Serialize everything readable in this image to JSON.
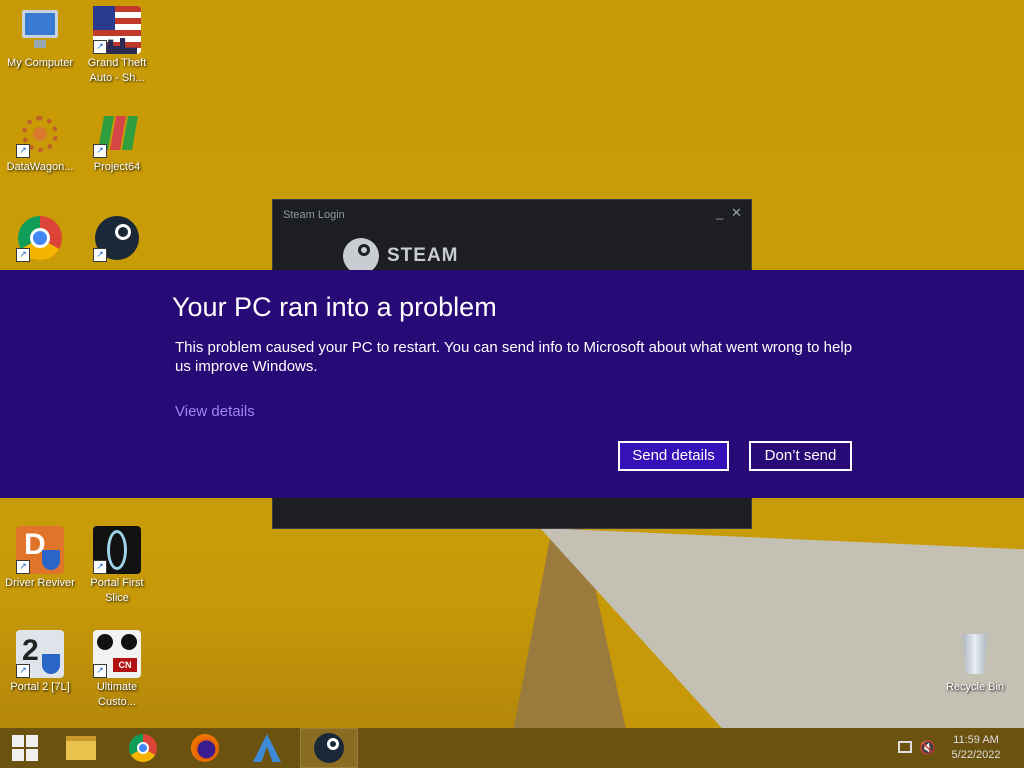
{
  "desktop": {
    "icons": [
      {
        "label": "My Computer"
      },
      {
        "label": "Grand Theft Auto - Sh..."
      },
      {
        "label": "DataWagon..."
      },
      {
        "label": "Project64"
      },
      {
        "label": "Google Chrome"
      },
      {
        "label": "Steam"
      },
      {
        "label": "Driver Reviver"
      },
      {
        "label": "Portal First Slice"
      },
      {
        "label": "Portal 2 [7L]"
      },
      {
        "label": "Ultimate Custo..."
      },
      {
        "label": "Recycle Bin"
      }
    ]
  },
  "steam_window": {
    "title": "Steam Login",
    "logo_text": "STEAM",
    "minimize_glyph": "_",
    "close_glyph": "✕"
  },
  "error_dialog": {
    "title": "Your PC ran into a problem",
    "message": "This problem caused your PC to restart. You can send info to Microsoft about what went wrong to help us improve Windows.",
    "link": "View details",
    "send_button": "Send details",
    "dont_send_button": "Don’t send"
  },
  "taskbar": {
    "items": [
      {
        "icon": "windows-start-icon"
      },
      {
        "icon": "file-explorer-icon"
      },
      {
        "icon": "chrome-icon"
      },
      {
        "icon": "firefox-icon"
      },
      {
        "icon": "app-icon"
      },
      {
        "icon": "steam-icon",
        "active": true
      }
    ],
    "time": "11:59 AM",
    "date": "5/22/2022"
  },
  "colors": {
    "dialog_bg": "#270a75",
    "link": "#9c86f2",
    "desktop_bg": "#c79a05"
  }
}
